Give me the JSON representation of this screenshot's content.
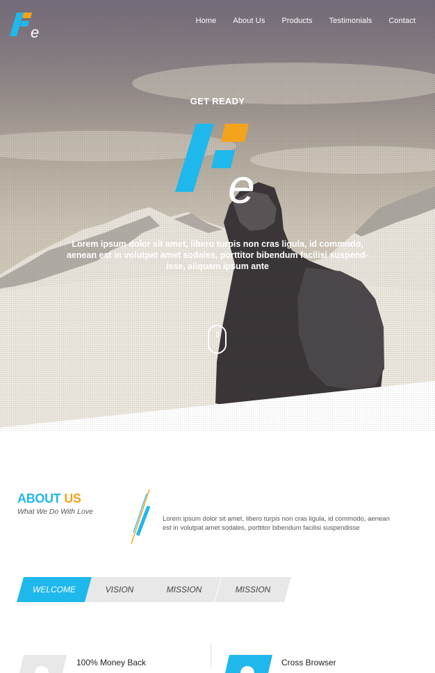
{
  "brand": {
    "name": "Fe",
    "logo_letter": "e",
    "colors": {
      "blue": "#1fb8ec",
      "orange": "#f4a31c",
      "white": "#ffffff"
    }
  },
  "nav": {
    "items": [
      "Home",
      "About Us",
      "Products",
      "Testimonials",
      "Contact"
    ]
  },
  "hero": {
    "kicker": "GET READY",
    "logo_letter": "e",
    "text": "Lorem ipsum dolor sit amet, libero turpis non cras ligula, id commodo, aenean est in volutpat amet sodales, porttitor bibendum facilisi suspend- isse, aliquam ipsum ante",
    "scroll_icon": "mouse-scroll-icon"
  },
  "about": {
    "title_part1": "ABOUT",
    "title_part2": "US",
    "subtitle": "What We Do With Love",
    "text": "Lorem ipsum dolor sit amet, libero turpis non cras ligula, id commodo, aenean est in volutpat amet sodales, porttitor bibendum facilisi suspendisse"
  },
  "tabs": {
    "items": [
      "WELCOME",
      "VISION",
      "MISSION",
      "MISSION"
    ],
    "active_index": 0,
    "active_color": "#1fb8ec",
    "inactive_color": "#e8e8e8"
  },
  "features": {
    "items": [
      {
        "title": "100% Money Back",
        "icon": "money-back-icon",
        "icon_bg": "#e8e8e8"
      },
      {
        "title": "Cross Browser",
        "icon": "browser-icon",
        "icon_bg": "#1fb8ec"
      }
    ]
  }
}
